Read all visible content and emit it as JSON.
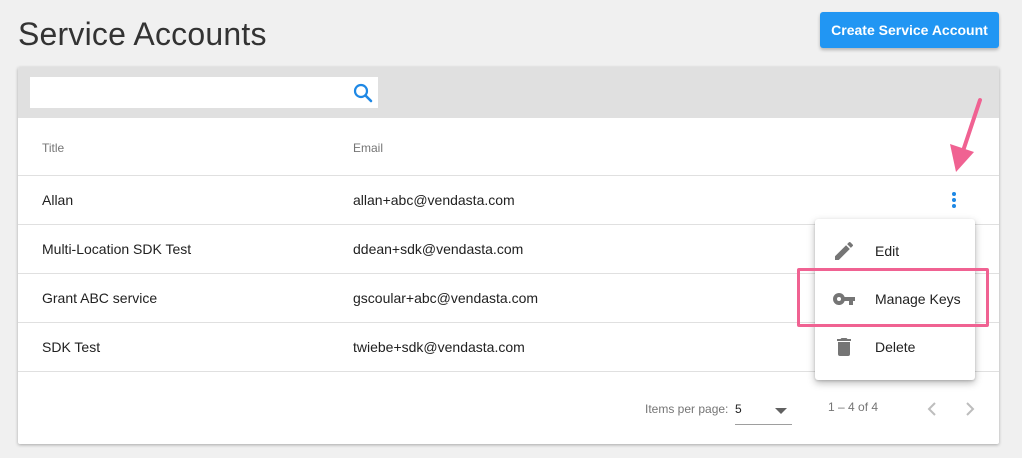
{
  "page": {
    "title": "Service Accounts"
  },
  "toolbar": {
    "create_label": "Create Service Account"
  },
  "search": {
    "placeholder": "",
    "value": ""
  },
  "table": {
    "columns": [
      "Title",
      "Email"
    ],
    "rows": [
      {
        "title": "Allan",
        "email": "allan+abc@vendasta.com"
      },
      {
        "title": "Multi-Location SDK Test",
        "email": "ddean+sdk@vendasta.com"
      },
      {
        "title": "Grant ABC service",
        "email": "gscoular+abc@vendasta.com"
      },
      {
        "title": "SDK Test",
        "email": "twiebe+sdk@vendasta.com"
      }
    ]
  },
  "menu": {
    "items": [
      {
        "label": "Edit",
        "icon": "pencil-icon"
      },
      {
        "label": "Manage Keys",
        "icon": "key-icon"
      },
      {
        "label": "Delete",
        "icon": "trash-icon"
      }
    ]
  },
  "pagination": {
    "items_per_page_label": "Items per page:",
    "items_per_page_value": "5",
    "range": "1 – 4 of 4"
  },
  "colors": {
    "primary": "#2196f3",
    "annotation": "#f06292"
  }
}
